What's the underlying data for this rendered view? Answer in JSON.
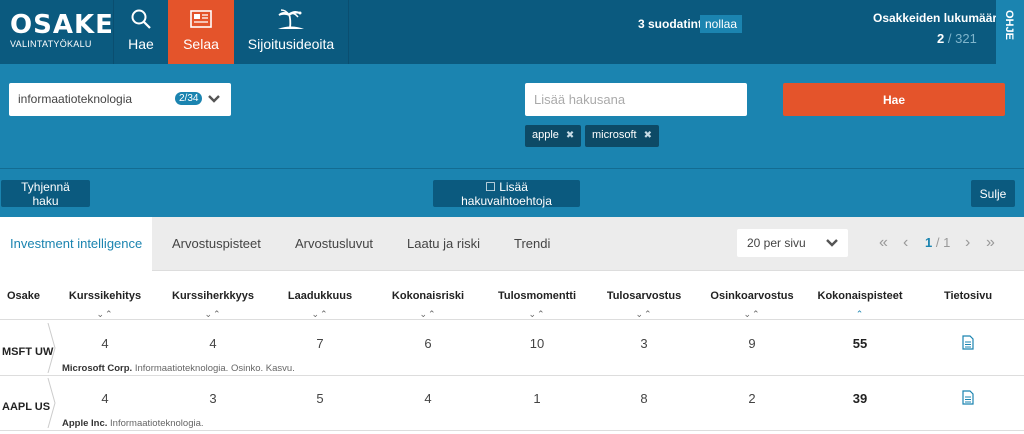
{
  "logo": {
    "title": "OSAKE",
    "subtitle": "VALINTATYÖKALU"
  },
  "nav": {
    "hae": "Hae",
    "selaa": "Selaa",
    "sijoitusideoita": "Sijoitusideoita"
  },
  "filters": {
    "text": "3 suodatinta",
    "reset": "nollaa"
  },
  "stock_count": {
    "label": "Osakkeiden lukumäärä",
    "shown": "2",
    "separator": "/",
    "total": "321"
  },
  "help": "OHJE",
  "search": {
    "industry_value": "informaatioteknologia",
    "industry_badge": "2/34",
    "placeholder": "Lisää hakusana",
    "submit": "Hae",
    "tags": [
      {
        "label": "apple"
      },
      {
        "label": "microsoft"
      }
    ],
    "clear": "Tyhjennä haku",
    "more_options": "☐ Lisää hakuvaihtoehtoja",
    "close": "Sulje"
  },
  "tabs": [
    {
      "label": "Investment intelligence",
      "active": true
    },
    {
      "label": "Arvostuspisteet"
    },
    {
      "label": "Arvostusluvut"
    },
    {
      "label": "Laatu ja riski"
    },
    {
      "label": "Trendi"
    }
  ],
  "per_page": "20 per sivu",
  "pagination": {
    "current": "1",
    "separator": "/",
    "total": "1"
  },
  "columns": [
    "Osake",
    "Kurssikehitys",
    "Kurssiherkkyys",
    "Laadukkuus",
    "Kokonaisriski",
    "Tulosmomentti",
    "Tulosarvostus",
    "Osinkoarvostus",
    "Kokonaispisteet",
    "Tietosivu"
  ],
  "rows": [
    {
      "ticker": "MSFT UW",
      "values": [
        "4",
        "4",
        "7",
        "6",
        "10",
        "3",
        "9",
        "55"
      ],
      "company": "Microsoft Corp.",
      "tags": "Informaatioteknologia. Osinko. Kasvu."
    },
    {
      "ticker": "AAPL US",
      "values": [
        "4",
        "3",
        "5",
        "4",
        "1",
        "8",
        "2",
        "39"
      ],
      "company": "Apple Inc.",
      "tags": "Informaatioteknologia."
    }
  ],
  "colors": {
    "topbar": "#0b5a7f",
    "panel": "#1b84b0",
    "accent": "#e4542b",
    "tag": "#0d4a66"
  },
  "icons": [
    "search-icon",
    "newspaper-icon",
    "palm-island-icon",
    "chevron-down-icon",
    "close-icon",
    "first-page-icon",
    "prev-page-icon",
    "next-page-icon",
    "last-page-icon",
    "sort-arrows-icon",
    "document-icon"
  ]
}
